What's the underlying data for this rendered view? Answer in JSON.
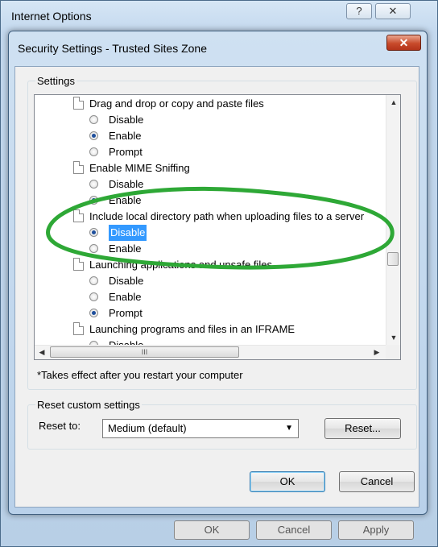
{
  "outer_window": {
    "title": "Internet Options",
    "help_label": "?",
    "close_label": "✕",
    "ghost_buttons": [
      "OK",
      "Cancel",
      "Apply"
    ]
  },
  "dialog": {
    "title": "Security Settings - Trusted Sites Zone",
    "close_label": "✕"
  },
  "settings": {
    "group_label": "Settings",
    "tree": [
      {
        "type": "item",
        "label": "Drag and drop or copy and paste files"
      },
      {
        "type": "option",
        "label": "Disable",
        "checked": false
      },
      {
        "type": "option",
        "label": "Enable",
        "checked": true
      },
      {
        "type": "option",
        "label": "Prompt",
        "checked": false
      },
      {
        "type": "item",
        "label": "Enable MIME Sniffing"
      },
      {
        "type": "option",
        "label": "Disable",
        "checked": false
      },
      {
        "type": "option",
        "label": "Enable",
        "checked": true
      },
      {
        "type": "item",
        "label": "Include local directory path when uploading files to a server"
      },
      {
        "type": "option",
        "label": "Disable",
        "checked": true,
        "selected": true
      },
      {
        "type": "option",
        "label": "Enable",
        "checked": false
      },
      {
        "type": "item",
        "label": "Launching applications and unsafe files"
      },
      {
        "type": "option",
        "label": "Disable",
        "checked": false
      },
      {
        "type": "option",
        "label": "Enable",
        "checked": false
      },
      {
        "type": "option",
        "label": "Prompt",
        "checked": true
      },
      {
        "type": "item",
        "label": "Launching programs and files in an IFRAME"
      },
      {
        "type": "option",
        "label": "Disable",
        "checked": false
      }
    ],
    "note": "*Takes effect after you restart your computer",
    "hscroll_grip": "III"
  },
  "reset": {
    "group_label": "Reset custom settings",
    "reset_to_label": "Reset to:",
    "selected_level": "Medium (default)",
    "reset_button": "Reset..."
  },
  "footer": {
    "ok_label": "OK",
    "cancel_label": "Cancel"
  },
  "colors": {
    "selection": "#3399ff",
    "highlight_oval": "#2ea836",
    "close_button": "#c84b2b"
  }
}
